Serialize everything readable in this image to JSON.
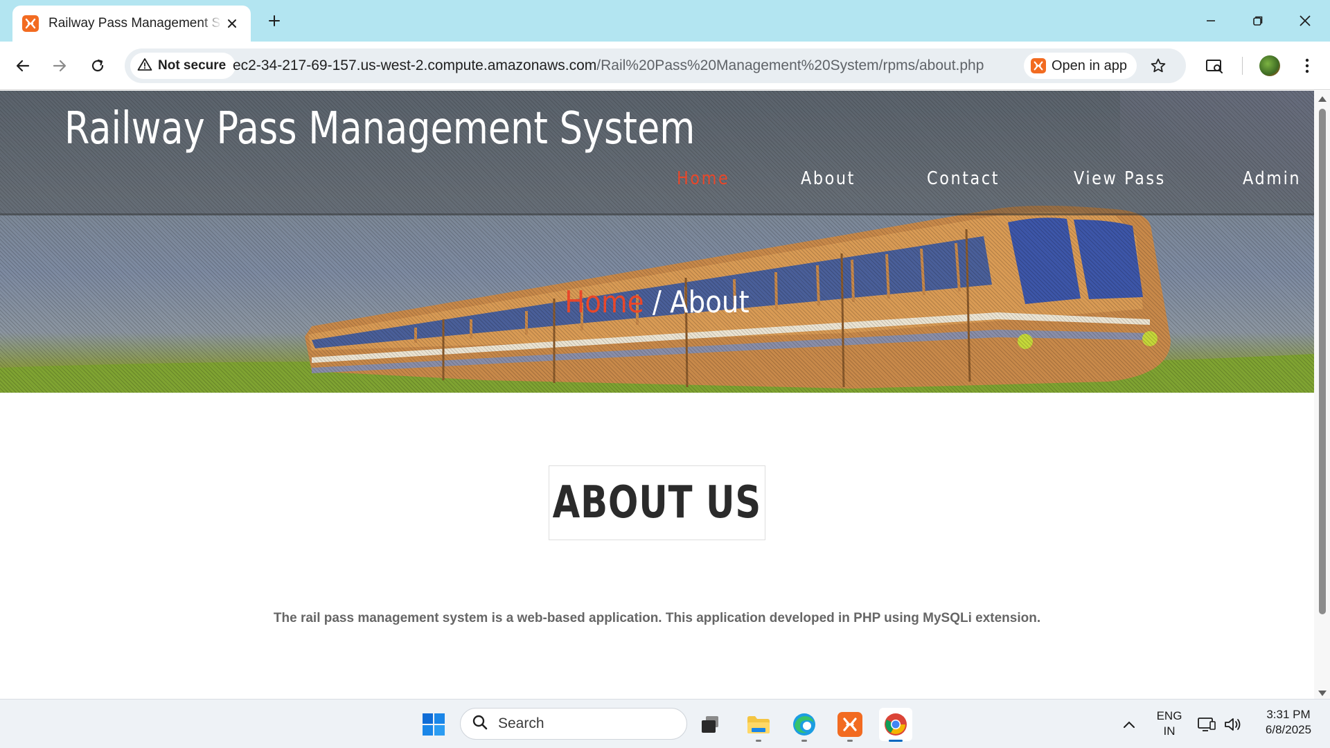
{
  "browser": {
    "tab_title": "Railway Pass Management System",
    "security_label": "Not secure",
    "url_host": "ec2-34-217-69-157.us-west-2.compute.amazonaws.com",
    "url_path": "/Rail%20Pass%20Management%20System/rpms/about.php",
    "open_in_app_label": "Open in app"
  },
  "site": {
    "title": "Railway Pass Management System",
    "nav": [
      "Home",
      "About",
      "Contact",
      "View Pass",
      "Admin"
    ],
    "active_nav": "Home",
    "breadcrumb": {
      "home": "Home",
      "separator": " / ",
      "current": "About"
    },
    "about_heading": "ABOUT US",
    "about_text": "The rail pass management system is a web-based application. This application developed in PHP using MySQLi extension."
  },
  "taskbar": {
    "search_placeholder": "Search",
    "lang_primary": "ENG",
    "lang_secondary": "IN",
    "time": "3:31 PM",
    "date": "6/8/2025"
  },
  "colors": {
    "accent": "#e8472a",
    "tabstrip": "#b3e5f1",
    "xampp_orange": "#f26b21"
  },
  "icons": [
    "xampp-icon",
    "close-icon",
    "plus-icon",
    "minimize-icon",
    "restore-icon",
    "back-icon",
    "forward-icon",
    "reload-icon",
    "warning-icon",
    "star-icon",
    "cast-icon",
    "kebab-icon",
    "windows-start-icon",
    "search-icon",
    "task-view-icon",
    "file-explorer-icon",
    "edge-icon",
    "chrome-icon",
    "chevron-up-icon",
    "display-icon",
    "speaker-icon"
  ]
}
